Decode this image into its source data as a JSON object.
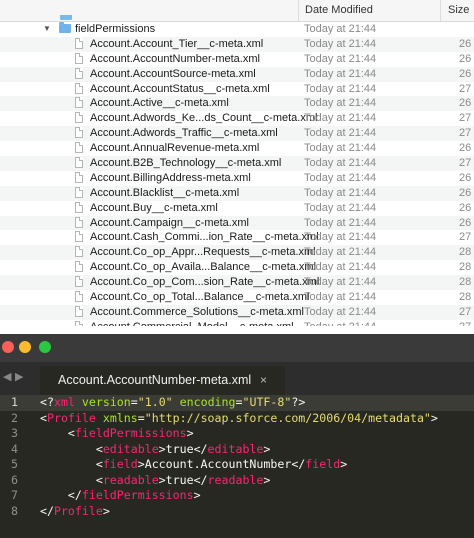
{
  "finder": {
    "headers": {
      "date_modified": "Date Modified",
      "size": "Size"
    },
    "folder": {
      "name": "fieldPermissions",
      "date": "Today at 21:44"
    },
    "files": [
      {
        "name": "Account.Account_Tier__c-meta.xml",
        "date": "Today at 21:44",
        "size": "26"
      },
      {
        "name": "Account.AccountNumber-meta.xml",
        "date": "Today at 21:44",
        "size": "26"
      },
      {
        "name": "Account.AccountSource-meta.xml",
        "date": "Today at 21:44",
        "size": "26"
      },
      {
        "name": "Account.AccountStatus__c-meta.xml",
        "date": "Today at 21:44",
        "size": "27"
      },
      {
        "name": "Account.Active__c-meta.xml",
        "date": "Today at 21:44",
        "size": "26"
      },
      {
        "name": "Account.Adwords_Ke...ds_Count__c-meta.xml",
        "date": "Today at 21:44",
        "size": "27"
      },
      {
        "name": "Account.Adwords_Traffic__c-meta.xml",
        "date": "Today at 21:44",
        "size": "27"
      },
      {
        "name": "Account.AnnualRevenue-meta.xml",
        "date": "Today at 21:44",
        "size": "26"
      },
      {
        "name": "Account.B2B_Technology__c-meta.xml",
        "date": "Today at 21:44",
        "size": "27"
      },
      {
        "name": "Account.BillingAddress-meta.xml",
        "date": "Today at 21:44",
        "size": "26"
      },
      {
        "name": "Account.Blacklist__c-meta.xml",
        "date": "Today at 21:44",
        "size": "26"
      },
      {
        "name": "Account.Buy__c-meta.xml",
        "date": "Today at 21:44",
        "size": "26"
      },
      {
        "name": "Account.Campaign__c-meta.xml",
        "date": "Today at 21:44",
        "size": "26"
      },
      {
        "name": "Account.Cash_Commi...ion_Rate__c-meta.xml",
        "date": "Today at 21:44",
        "size": "27"
      },
      {
        "name": "Account.Co_op_Appr...Requests__c-meta.xml",
        "date": "Today at 21:44",
        "size": "28"
      },
      {
        "name": "Account.Co_op_Availa...Balance__c-meta.xml",
        "date": "Today at 21:44",
        "size": "28"
      },
      {
        "name": "Account.Co_op_Com...sion_Rate__c-meta.xml",
        "date": "Today at 21:44",
        "size": "28"
      },
      {
        "name": "Account.Co_op_Total...Balance__c-meta.xml",
        "date": "Today at 21:44",
        "size": "28"
      },
      {
        "name": "Account.Commerce_Solutions__c-meta.xml",
        "date": "Today at 21:44",
        "size": "27"
      },
      {
        "name": "Account.Commercial_Model__c-meta.xml",
        "date": "Today at 21:44",
        "size": "27"
      }
    ]
  },
  "editor": {
    "tab_title": "Account.AccountNumber-meta.xml",
    "tab_close": "×",
    "nav_back": "◀",
    "nav_forward": "▶",
    "lines": [
      {
        "n": "1",
        "text": "<?xml version=\"1.0\" encoding=\"UTF-8\"?>"
      },
      {
        "n": "2",
        "text": "<Profile xmlns=\"http://soap.sforce.com/2006/04/metadata\">"
      },
      {
        "n": "3",
        "text": "    <fieldPermissions>"
      },
      {
        "n": "4",
        "text": "        <editable>true</editable>"
      },
      {
        "n": "5",
        "text": "        <field>Account.AccountNumber</field>"
      },
      {
        "n": "6",
        "text": "        <readable>true</readable>"
      },
      {
        "n": "7",
        "text": "    </fieldPermissions>"
      },
      {
        "n": "8",
        "text": "</Profile>"
      }
    ]
  },
  "colors": {
    "tag": "#f92672",
    "attr": "#a6e22e",
    "string": "#e6db74",
    "plain": "#f8f8f2",
    "editor_bg": "#272822",
    "traffic_red": "#fc5f57",
    "traffic_yellow": "#fdbc2e",
    "traffic_green": "#2ac841"
  }
}
